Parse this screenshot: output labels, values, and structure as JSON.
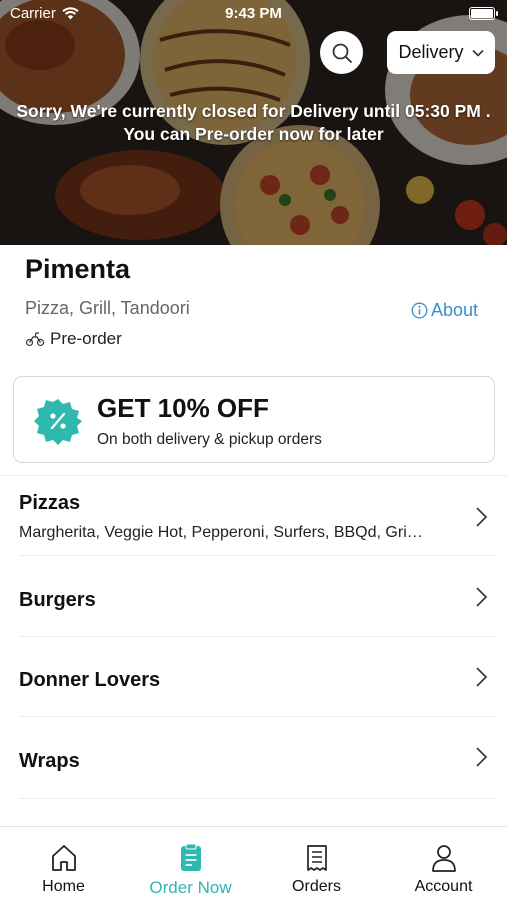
{
  "status_bar": {
    "carrier": "Carrier",
    "time": "9:43 PM"
  },
  "header": {
    "delivery_mode": "Delivery",
    "closed_message_line1": "Sorry, We're currently closed for Delivery until 05:30 PM .",
    "closed_message_line2": "You can Pre-order now for later"
  },
  "restaurant": {
    "name": "Pimenta",
    "cuisine": "Pizza, Grill, Tandoori",
    "about_label": "About",
    "order_type": "Pre-order"
  },
  "offer": {
    "title": "GET 10% OFF",
    "subtitle": "On both delivery & pickup orders"
  },
  "categories": [
    {
      "name": "Pizzas",
      "items": "Margherita, Veggie Hot, Pepperoni, Surfers, BBQd, Gri…"
    },
    {
      "name": "Burgers"
    },
    {
      "name": "Donner Lovers"
    },
    {
      "name": "Wraps"
    }
  ],
  "tabs": [
    {
      "label": "Home",
      "icon": "home-icon"
    },
    {
      "label": "Order Now",
      "icon": "order-icon",
      "active": true
    },
    {
      "label": "Orders",
      "icon": "receipt-icon"
    },
    {
      "label": "Account",
      "icon": "person-icon"
    }
  ],
  "colors": {
    "accent": "#2fb8ae",
    "link": "#3b8fc9"
  }
}
